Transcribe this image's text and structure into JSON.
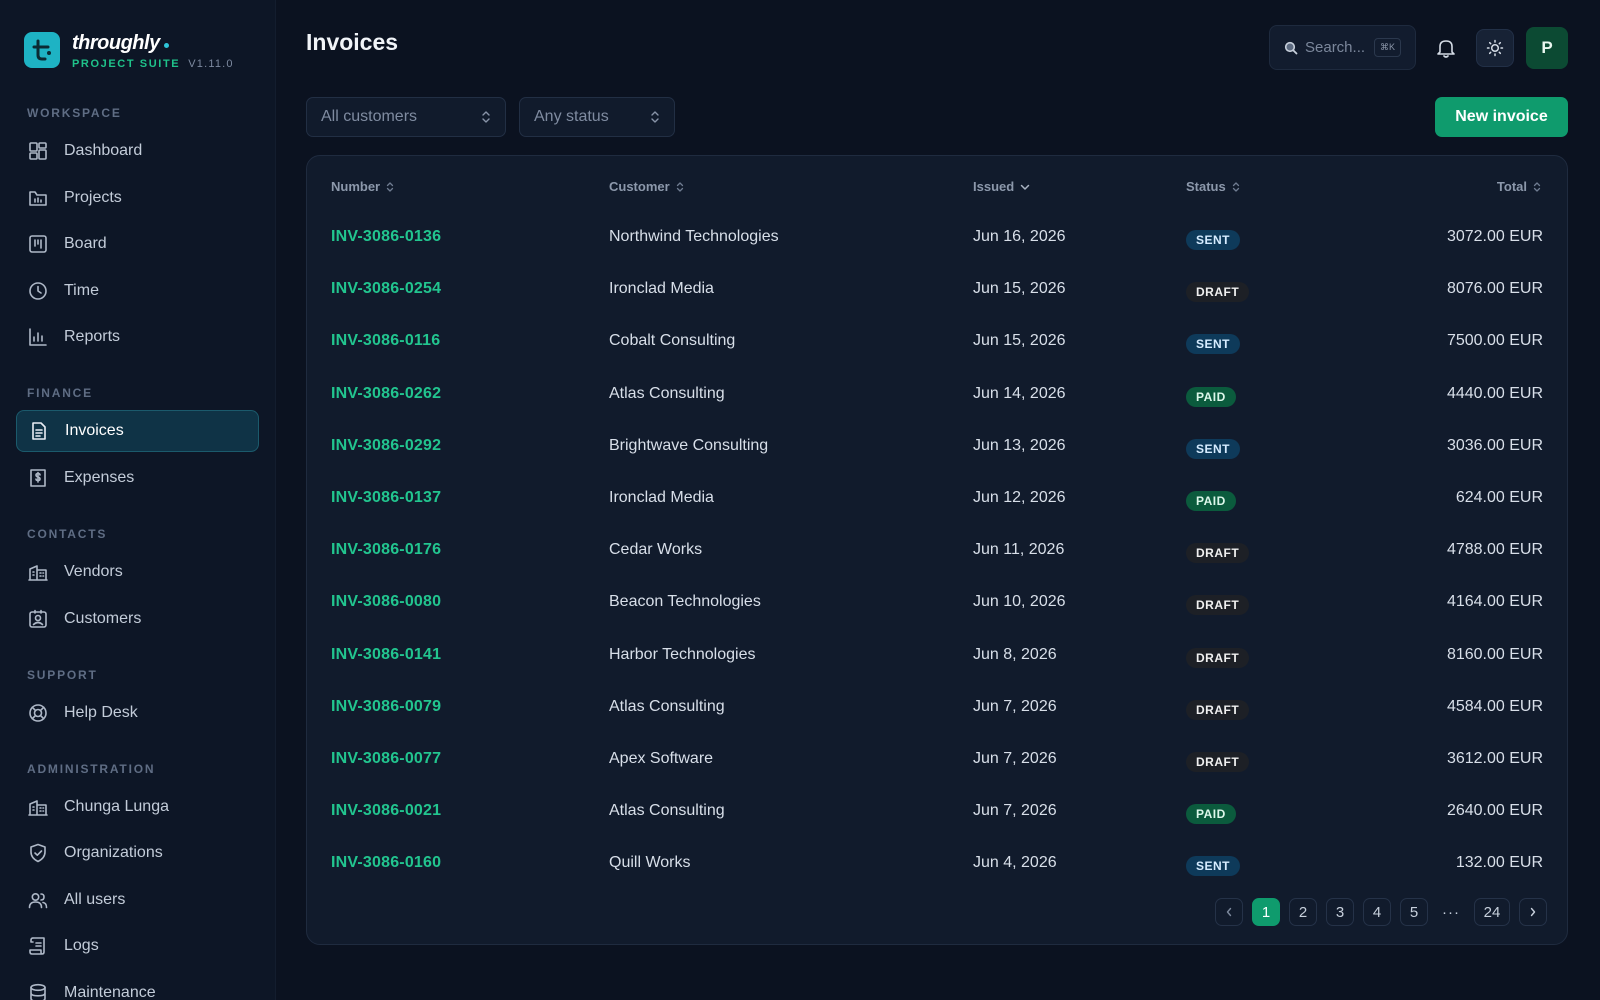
{
  "brand": {
    "name": "throughly",
    "suite": "PROJECT SUITE",
    "version": "V1.11.0"
  },
  "sidebar": {
    "sections": [
      {
        "heading": "WORKSPACE",
        "items": [
          {
            "label": "Dashboard",
            "icon": "dashboard-icon"
          },
          {
            "label": "Projects",
            "icon": "projects-icon"
          },
          {
            "label": "Board",
            "icon": "board-icon"
          },
          {
            "label": "Time",
            "icon": "clock-icon"
          },
          {
            "label": "Reports",
            "icon": "reports-icon"
          }
        ]
      },
      {
        "heading": "FINANCE",
        "items": [
          {
            "label": "Invoices",
            "icon": "invoice-icon",
            "active": true
          },
          {
            "label": "Expenses",
            "icon": "expenses-icon"
          }
        ]
      },
      {
        "heading": "CONTACTS",
        "items": [
          {
            "label": "Vendors",
            "icon": "building-icon"
          },
          {
            "label": "Customers",
            "icon": "contact-card-icon"
          }
        ]
      },
      {
        "heading": "SUPPORT",
        "items": [
          {
            "label": "Help Desk",
            "icon": "lifebuoy-icon"
          }
        ]
      },
      {
        "heading": "ADMINISTRATION",
        "items": [
          {
            "label": "Chunga Lunga",
            "icon": "building-icon"
          },
          {
            "label": "Organizations",
            "icon": "shield-icon"
          },
          {
            "label": "All users",
            "icon": "users-icon"
          },
          {
            "label": "Logs",
            "icon": "scroll-icon"
          },
          {
            "label": "Maintenance",
            "icon": "database-icon"
          }
        ]
      }
    ]
  },
  "header": {
    "title": "Invoices",
    "search_placeholder": "Search...",
    "search_shortcut": "⌘K",
    "avatar_initial": "P"
  },
  "filters": {
    "customer": "All customers",
    "status": "Any status",
    "new_button": "New invoice"
  },
  "table": {
    "columns": {
      "number": "Number",
      "customer": "Customer",
      "issued": "Issued",
      "status": "Status",
      "total": "Total"
    },
    "rows": [
      {
        "number": "INV-3086-0136",
        "customer": "Northwind Technologies",
        "issued": "Jun 16, 2026",
        "status": "SENT",
        "total": "3072.00 EUR"
      },
      {
        "number": "INV-3086-0254",
        "customer": "Ironclad Media",
        "issued": "Jun 15, 2026",
        "status": "DRAFT",
        "total": "8076.00 EUR"
      },
      {
        "number": "INV-3086-0116",
        "customer": "Cobalt Consulting",
        "issued": "Jun 15, 2026",
        "status": "SENT",
        "total": "7500.00 EUR"
      },
      {
        "number": "INV-3086-0262",
        "customer": "Atlas Consulting",
        "issued": "Jun 14, 2026",
        "status": "PAID",
        "total": "4440.00 EUR"
      },
      {
        "number": "INV-3086-0292",
        "customer": "Brightwave Consulting",
        "issued": "Jun 13, 2026",
        "status": "SENT",
        "total": "3036.00 EUR"
      },
      {
        "number": "INV-3086-0137",
        "customer": "Ironclad Media",
        "issued": "Jun 12, 2026",
        "status": "PAID",
        "total": "624.00 EUR"
      },
      {
        "number": "INV-3086-0176",
        "customer": "Cedar Works",
        "issued": "Jun 11, 2026",
        "status": "DRAFT",
        "total": "4788.00 EUR"
      },
      {
        "number": "INV-3086-0080",
        "customer": "Beacon Technologies",
        "issued": "Jun 10, 2026",
        "status": "DRAFT",
        "total": "4164.00 EUR"
      },
      {
        "number": "INV-3086-0141",
        "customer": "Harbor Technologies",
        "issued": "Jun 8, 2026",
        "status": "DRAFT",
        "total": "8160.00 EUR"
      },
      {
        "number": "INV-3086-0079",
        "customer": "Atlas Consulting",
        "issued": "Jun 7, 2026",
        "status": "DRAFT",
        "total": "4584.00 EUR"
      },
      {
        "number": "INV-3086-0077",
        "customer": "Apex Software",
        "issued": "Jun 7, 2026",
        "status": "DRAFT",
        "total": "3612.00 EUR"
      },
      {
        "number": "INV-3086-0021",
        "customer": "Atlas Consulting",
        "issued": "Jun 7, 2026",
        "status": "PAID",
        "total": "2640.00 EUR"
      },
      {
        "number": "INV-3086-0160",
        "customer": "Quill Works",
        "issued": "Jun 4, 2026",
        "status": "SENT",
        "total": "132.00 EUR"
      }
    ]
  },
  "pagination": {
    "pages": [
      "1",
      "2",
      "3",
      "4",
      "5"
    ],
    "current": "1",
    "ellipsis": "···",
    "last": "24"
  },
  "colors": {
    "accent": "#0f9b6d",
    "link": "#22c58f",
    "brand_logo": "#1eb3c4",
    "sent_badge": "#0e3a5a",
    "draft_badge": "#1d2026",
    "paid_badge": "#0b5b3d"
  }
}
